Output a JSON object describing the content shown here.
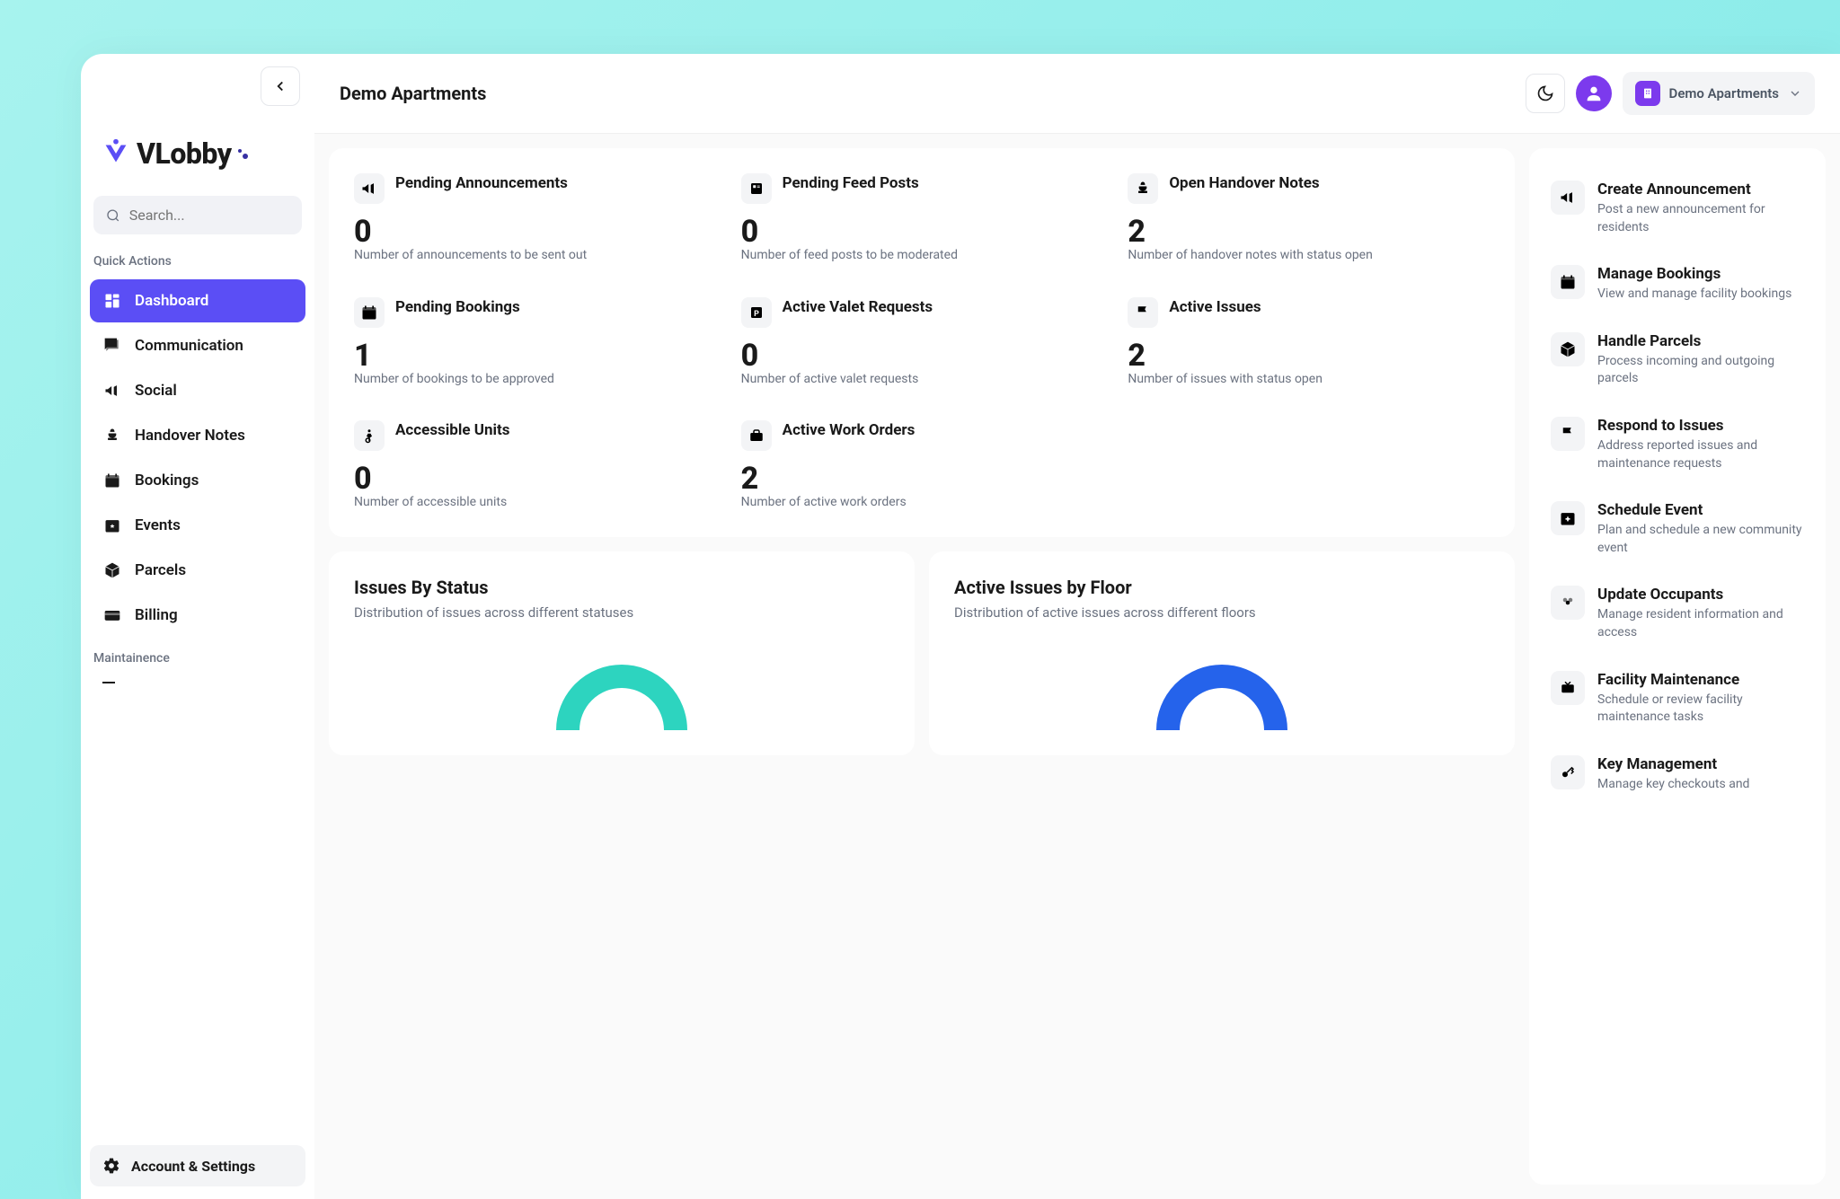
{
  "brand": "VLobby",
  "search": {
    "placeholder": "Search..."
  },
  "page_title": "Demo Apartments",
  "property_selector": {
    "label": "Demo Apartments"
  },
  "sidebar": {
    "quick_actions_label": "Quick Actions",
    "maintenance_label": "Maintainence",
    "account_label": "Account & Settings",
    "items": [
      {
        "label": "Dashboard",
        "icon": "dashboard",
        "active": true
      },
      {
        "label": "Communication",
        "icon": "chat"
      },
      {
        "label": "Social",
        "icon": "megaphone"
      },
      {
        "label": "Handover Notes",
        "icon": "handover"
      },
      {
        "label": "Bookings",
        "icon": "calendar"
      },
      {
        "label": "Events",
        "icon": "calendar-star"
      },
      {
        "label": "Parcels",
        "icon": "box"
      },
      {
        "label": "Billing",
        "icon": "card"
      }
    ]
  },
  "stats": [
    {
      "title": "Pending Announcements",
      "value": "0",
      "desc": "Number of announcements to be sent out",
      "icon": "megaphone"
    },
    {
      "title": "Pending Feed Posts",
      "value": "0",
      "desc": "Number of feed posts to be moderated",
      "icon": "feed"
    },
    {
      "title": "Open Handover Notes",
      "value": "2",
      "desc": "Number of handover notes with status open",
      "icon": "handover"
    },
    {
      "title": "Pending Bookings",
      "value": "1",
      "desc": "Number of bookings to be approved",
      "icon": "calendar"
    },
    {
      "title": "Active Valet Requests",
      "value": "0",
      "desc": "Number of active valet requests",
      "icon": "parking"
    },
    {
      "title": "Active Issues",
      "value": "2",
      "desc": "Number of issues with status open",
      "icon": "flag"
    },
    {
      "title": "Accessible Units",
      "value": "0",
      "desc": "Number of accessible units",
      "icon": "accessible"
    },
    {
      "title": "Active Work Orders",
      "value": "2",
      "desc": "Number of active work orders",
      "icon": "briefcase"
    }
  ],
  "charts": [
    {
      "title": "Issues By Status",
      "desc": "Distribution of issues across different statuses",
      "color": "#2dd4bf"
    },
    {
      "title": "Active Issues by Floor",
      "desc": "Distribution of active issues across different floors",
      "color": "#2563eb"
    }
  ],
  "actions": [
    {
      "title": "Create Announcement",
      "desc": "Post a new announcement for residents",
      "icon": "megaphone"
    },
    {
      "title": "Manage Bookings",
      "desc": "View and manage facility bookings",
      "icon": "calendar"
    },
    {
      "title": "Handle Parcels",
      "desc": "Process incoming and outgoing parcels",
      "icon": "box"
    },
    {
      "title": "Respond to Issues",
      "desc": "Address reported issues and maintenance requests",
      "icon": "flag"
    },
    {
      "title": "Schedule Event",
      "desc": "Plan and schedule a new community event",
      "icon": "calendar-plus"
    },
    {
      "title": "Update Occupants",
      "desc": "Manage resident information and access",
      "icon": "people"
    },
    {
      "title": "Facility Maintenance",
      "desc": "Schedule or review facility maintenance tasks",
      "icon": "tv"
    },
    {
      "title": "Key Management",
      "desc": "Manage key checkouts and",
      "icon": "key"
    }
  ]
}
